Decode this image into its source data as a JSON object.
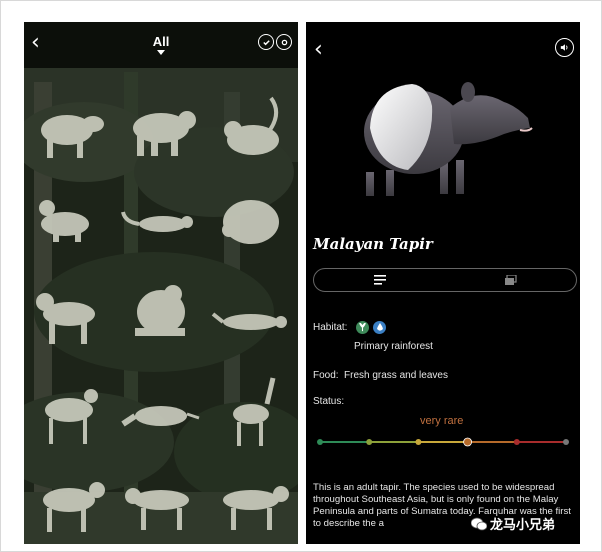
{
  "gallery": {
    "header": {
      "back_icon": "chevron-left-icon",
      "filter_label": "All",
      "filter_icon": "caret-down-icon",
      "action_icons": [
        "check-circle-icon",
        "swap-circle-icon"
      ]
    },
    "animals": [
      "tapir-silhouette",
      "bear-silhouette",
      "rodent-silhouette",
      "pangolin-silhouette",
      "weasel-silhouette",
      "porcupine-silhouette",
      "cat-silhouette",
      "gorilla-silhouette",
      "civet-silhouette",
      "deer-silhouette",
      "anteater-silhouette",
      "antelope-silhouette",
      "dog-silhouette",
      "wildcat-silhouette",
      "leopard-silhouette"
    ]
  },
  "detail": {
    "back_icon": "chevron-left-icon",
    "sound_icon": "speaker-icon",
    "name": "Malayan Tapir",
    "toggle": {
      "left_icon": "text-lines-icon",
      "right_icon": "cards-icon"
    },
    "habitat": {
      "label": "Habitat:",
      "icons": [
        {
          "name": "plant-icon",
          "color": "#3e8a5a"
        },
        {
          "name": "water-drop-icon",
          "color": "#3a7fc4"
        }
      ],
      "value": "Primary rainforest"
    },
    "food": {
      "label": "Food:",
      "value": "Fresh grass and leaves"
    },
    "status": {
      "label": "Status:",
      "value": "very rare",
      "value_color": "#c0703f",
      "scale_colors": [
        "#2e8b57",
        "#8da13a",
        "#c8a83a",
        "#b56a2a",
        "#a82c2c",
        "#777777"
      ],
      "levels": 6,
      "selected_level": 4
    },
    "description": "This is an adult tapir. The species used to be widespread throughout Southeast Asia, but is only found on the Malay Peninsula and parts of Sumatra today. Farquhar was the first to describe the a"
  },
  "watermark": {
    "text": "龙马小兄弟"
  }
}
